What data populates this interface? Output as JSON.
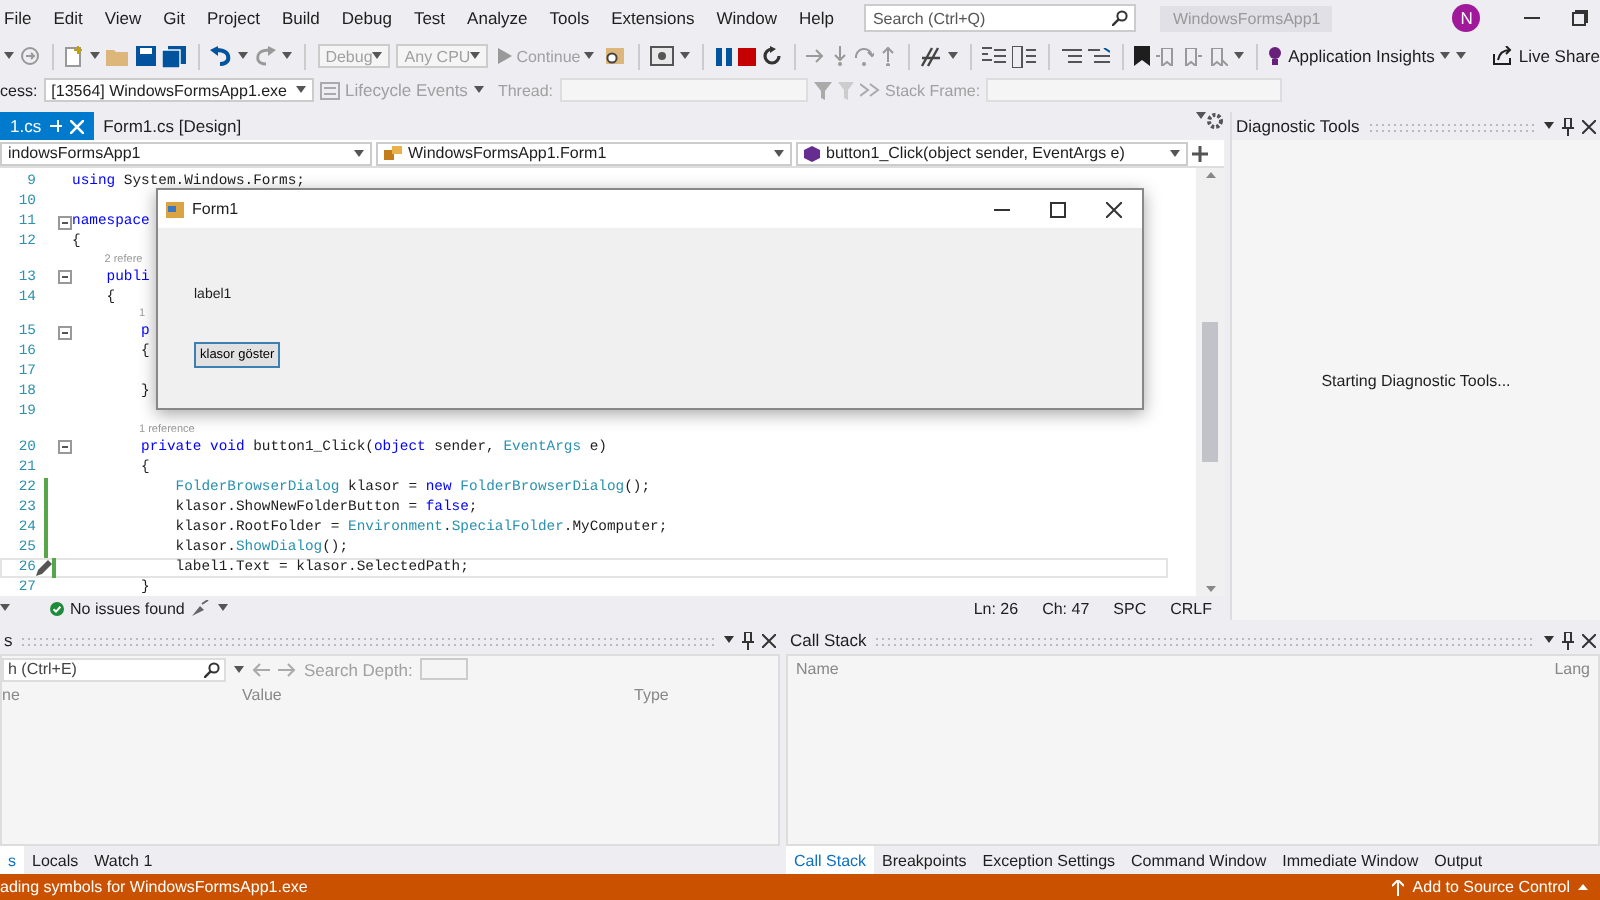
{
  "menu_bar": {
    "items": [
      "File",
      "Edit",
      "View",
      "Git",
      "Project",
      "Build",
      "Debug",
      "Test",
      "Analyze",
      "Tools",
      "Extensions",
      "Window",
      "Help"
    ],
    "search": {
      "placeholder": "Search (Ctrl+Q)"
    },
    "solution_name": "WindowsFormsApp1",
    "avatar": "N"
  },
  "toolbar": {
    "configuration": {
      "value": "Debug",
      "disabled": true
    },
    "platform": {
      "value": "Any CPU",
      "disabled": true
    },
    "continue": {
      "label": "Continue",
      "disabled": true
    },
    "application_insights": "Application Insights",
    "live_share": "Live Share"
  },
  "debug_location": {
    "process_label": "cess:",
    "process": "[13564] WindowsFormsApp1.exe",
    "lifecycle": "Lifecycle Events",
    "thread_label": "Thread:",
    "stack_frame_label": "Stack Frame:"
  },
  "editor": {
    "tabs": [
      {
        "label": "1.cs",
        "selected": true
      },
      {
        "label": "Form1.cs [Design]",
        "selected": false
      }
    ],
    "navigation": [
      "indowsFormsApp1",
      "WindowsFormsApp1.Form1",
      "button1_Click(object sender, EventArgs e)"
    ],
    "lines": [
      {
        "number": "9",
        "changed": false,
        "foldable": false,
        "current": false,
        "tokens": [
          {
            "text": "using",
            "kind": "keyword"
          },
          {
            "text": " System.Windows.Forms;",
            "kind": "plain"
          }
        ]
      },
      {
        "number": "10",
        "changed": false,
        "foldable": false,
        "current": false
      },
      {
        "number": "11",
        "changed": false,
        "foldable": true,
        "current": false,
        "tokens": [
          {
            "text": "namespace",
            "kind": "keyword"
          }
        ]
      },
      {
        "number": "12",
        "changed": false,
        "foldable": false,
        "current": false,
        "tokens": [
          {
            "text": "{",
            "kind": "plain"
          }
        ]
      },
      {
        "lens": "    2 refere"
      },
      {
        "number": "13",
        "changed": false,
        "foldable": true,
        "current": false,
        "tokens": [
          {
            "text": "    publi",
            "kind": "keyword"
          }
        ]
      },
      {
        "number": "14",
        "changed": false,
        "foldable": false,
        "current": false,
        "tokens": [
          {
            "text": "    {",
            "kind": "plain"
          }
        ]
      },
      {
        "lens": "        1"
      },
      {
        "number": "15",
        "changed": false,
        "foldable": true,
        "current": false,
        "tokens": [
          {
            "text": "        p",
            "kind": "keyword"
          }
        ]
      },
      {
        "number": "16",
        "changed": false,
        "foldable": false,
        "current": false,
        "tokens": [
          {
            "text": "        {",
            "kind": "plain"
          }
        ]
      },
      {
        "number": "17",
        "changed": false,
        "foldable": false,
        "current": false
      },
      {
        "number": "18",
        "changed": false,
        "foldable": false,
        "current": false,
        "tokens": [
          {
            "text": "        }",
            "kind": "plain"
          }
        ]
      },
      {
        "number": "19",
        "changed": false,
        "foldable": false,
        "current": false
      },
      {
        "lens": "        1 reference"
      },
      {
        "number": "20",
        "changed": false,
        "foldable": true,
        "current": false,
        "tokens": [
          {
            "text": "        private void",
            "kind": "keyword"
          },
          {
            "text": " button1_Click(",
            "kind": "plain"
          },
          {
            "text": "object",
            "kind": "keyword"
          },
          {
            "text": " sender, ",
            "kind": "plain"
          },
          {
            "text": "EventArgs",
            "kind": "type"
          },
          {
            "text": " e)",
            "kind": "plain"
          }
        ]
      },
      {
        "number": "21",
        "changed": false,
        "foldable": false,
        "current": false,
        "tokens": [
          {
            "text": "        {",
            "kind": "plain"
          }
        ]
      },
      {
        "number": "22",
        "changed": true,
        "foldable": false,
        "current": false,
        "tokens": [
          {
            "text": "            FolderBrowserDialog",
            "kind": "type"
          },
          {
            "text": " klasor = ",
            "kind": "plain"
          },
          {
            "text": "new",
            "kind": "keyword"
          },
          {
            "text": " FolderBrowserDialog",
            "kind": "type"
          },
          {
            "text": "();",
            "kind": "plain"
          }
        ]
      },
      {
        "number": "23",
        "changed": true,
        "foldable": false,
        "current": false,
        "tokens": [
          {
            "text": "            klasor.ShowNewFolderButton = ",
            "kind": "plain"
          },
          {
            "text": "false",
            "kind": "keyword"
          },
          {
            "text": ";",
            "kind": "plain"
          }
        ]
      },
      {
        "number": "24",
        "changed": true,
        "foldable": false,
        "current": false,
        "tokens": [
          {
            "text": "            klasor.RootFolder = ",
            "kind": "plain"
          },
          {
            "text": "Environment",
            "kind": "type"
          },
          {
            "text": ".",
            "kind": "plain"
          },
          {
            "text": "SpecialFolder",
            "kind": "type"
          },
          {
            "text": ".MyComputer;",
            "kind": "plain"
          }
        ]
      },
      {
        "number": "25",
        "changed": true,
        "foldable": false,
        "current": false,
        "tokens": [
          {
            "text": "            klasor.",
            "kind": "plain"
          },
          {
            "text": "ShowDialog",
            "kind": "type"
          },
          {
            "text": "();",
            "kind": "plain"
          }
        ]
      },
      {
        "number": "26",
        "changed": true,
        "foldable": false,
        "current": true,
        "tokens": [
          {
            "text": "            label1.Text = klasor.SelectedPath;",
            "kind": "plain"
          }
        ]
      },
      {
        "number": "27",
        "changed": false,
        "foldable": false,
        "current": false,
        "tokens": [
          {
            "text": "        }",
            "kind": "plain"
          }
        ]
      }
    ],
    "status": {
      "issues": "No issues found",
      "line": "Ln: 26",
      "column": "Ch: 47",
      "whitespace": "SPC",
      "line_ending": "CRLF"
    }
  },
  "form_window": {
    "title": "Form1",
    "label": "label1",
    "button": "klasor göster"
  },
  "diagnostic_tools": {
    "title": "Diagnostic Tools",
    "message": "Starting Diagnostic Tools..."
  },
  "watch_panel": {
    "title": "s",
    "search": {
      "placeholder": "h (Ctrl+E)"
    },
    "search_depth": "Search Depth:",
    "columns": [
      "ne",
      "Value",
      "Type"
    ],
    "tabs": [
      {
        "label": "s",
        "selected": true
      },
      {
        "label": "Locals",
        "selected": false
      },
      {
        "label": "Watch 1",
        "selected": false
      }
    ]
  },
  "call_stack_panel": {
    "title": "Call Stack",
    "columns": [
      "Name",
      "Lang"
    ],
    "tabs": [
      {
        "label": "Call Stack",
        "selected": true
      },
      {
        "label": "Breakpoints",
        "selected": false
      },
      {
        "label": "Exception Settings",
        "selected": false
      },
      {
        "label": "Command Window",
        "selected": false
      },
      {
        "label": "Immediate Window",
        "selected": false
      },
      {
        "label": "Output",
        "selected": false
      }
    ]
  },
  "status_bar": {
    "message": "ading symbols for WindowsFormsApp1.exe",
    "source_control": "Add to Source Control"
  }
}
